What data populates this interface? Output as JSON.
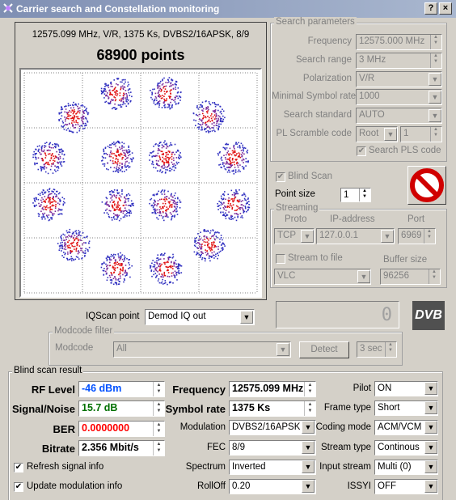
{
  "window": {
    "title": "Carrier search and Constellation monitoring",
    "help": "?",
    "close": "×"
  },
  "scope": {
    "info": "12575.099 MHz, V/R, 1375 Ks, DVBS2/16APSK, 8/9",
    "points": "68900 points"
  },
  "search": {
    "title": "Search parameters",
    "frequency_label": "Frequency",
    "frequency": "12575.000 MHz",
    "range_label": "Search range",
    "range": "3 MHz",
    "polarization_label": "Polarization",
    "polarization": "V/R",
    "min_sr_label": "Minimal Symbol rate",
    "min_sr": "1000",
    "standard_label": "Search standard",
    "standard": "AUTO",
    "pls_label": "PL Scramble code",
    "pls_mode": "Root",
    "pls_value": "1",
    "search_pls_label": "Search PLS code"
  },
  "blind_scan_label": "Blind Scan",
  "point_size_label": "Point size",
  "point_size": "1",
  "streaming": {
    "title": "Streaming",
    "proto_label": "Proto",
    "ip_label": "IP-address",
    "port_label": "Port",
    "proto": "TCP",
    "ip": "127.0.0.1",
    "port": "6969",
    "stream_file_label": "Stream to file",
    "buffer_label": "Buffer size",
    "player": "VLC",
    "buffer": "96256"
  },
  "iq": {
    "label": "IQScan point",
    "value": "Demod IQ out"
  },
  "counter": "0",
  "dvb_logo": "DVB",
  "modcode": {
    "title": "Modcode filter",
    "label": "Modcode",
    "value": "All",
    "detect": "Detect",
    "interval": "3 sec"
  },
  "result": {
    "title": "Blind scan result",
    "rf_label": "RF Level",
    "rf": "-46 dBm",
    "snr_label": "Signal/Noise",
    "snr": "15.7 dB",
    "ber_label": "BER",
    "ber": "0.0000000",
    "bitrate_label": "Bitrate",
    "bitrate": "2.356 Mbit/s",
    "freq_label": "Frequency",
    "freq": "12575.099 MHz",
    "sr_label": "Symbol rate",
    "sr": "1375 Ks",
    "mod_label": "Modulation",
    "mod": "DVBS2/16APSK",
    "fec_label": "FEC",
    "fec": "8/9",
    "spectrum_label": "Spectrum",
    "spectrum": "Inverted",
    "rolloff_label": "RollOff",
    "rolloff": "0.20",
    "pilot_label": "Pilot",
    "pilot": "ON",
    "frame_label": "Frame type",
    "frame": "Short",
    "coding_label": "Coding mode",
    "coding": "ACM/VCM",
    "stype_label": "Stream type",
    "stype": "Continous",
    "istream_label": "Input stream",
    "istream": "Multi (0)",
    "issyi_label": "ISSYI",
    "issyi": "OFF",
    "refresh_label": "Refresh signal info",
    "update_label": "Update modulation info"
  },
  "colors": {
    "rf": "#0050ff",
    "snr": "#007000",
    "ber": "#ff0000",
    "title_bg": "#8795b6",
    "dots": "#3030c0",
    "cluster_core": "#e01010"
  },
  "constellation": {
    "type": "16APSK",
    "inner_ring_points": 4,
    "outer_ring_points": 12
  }
}
